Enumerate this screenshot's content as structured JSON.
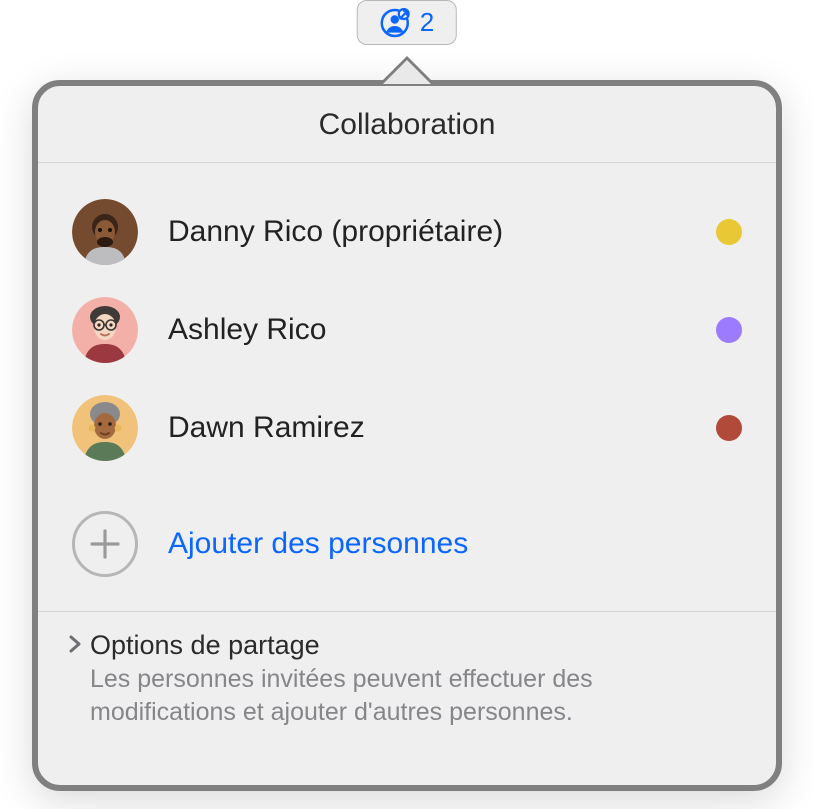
{
  "toolbar": {
    "collab_count": "2"
  },
  "popover": {
    "title": "Collaboration",
    "participants": [
      {
        "name": "Danny Rico (propriétaire)",
        "dot_color": "#e9c836",
        "avatar": {
          "bg": "#754b2f",
          "type": "danny"
        }
      },
      {
        "name": "Ashley Rico",
        "dot_color": "#9d7bff",
        "avatar": {
          "bg": "#f3b0a9",
          "type": "ashley"
        }
      },
      {
        "name": "Dawn Ramirez",
        "dot_color": "#b24a3a",
        "avatar": {
          "bg": "#f0c27a",
          "type": "dawn"
        }
      }
    ],
    "add_label": "Ajouter des personnes",
    "footer": {
      "title": "Options de partage",
      "description": "Les personnes invitées peuvent effectuer des modifications et ajouter d'autres personnes."
    }
  }
}
